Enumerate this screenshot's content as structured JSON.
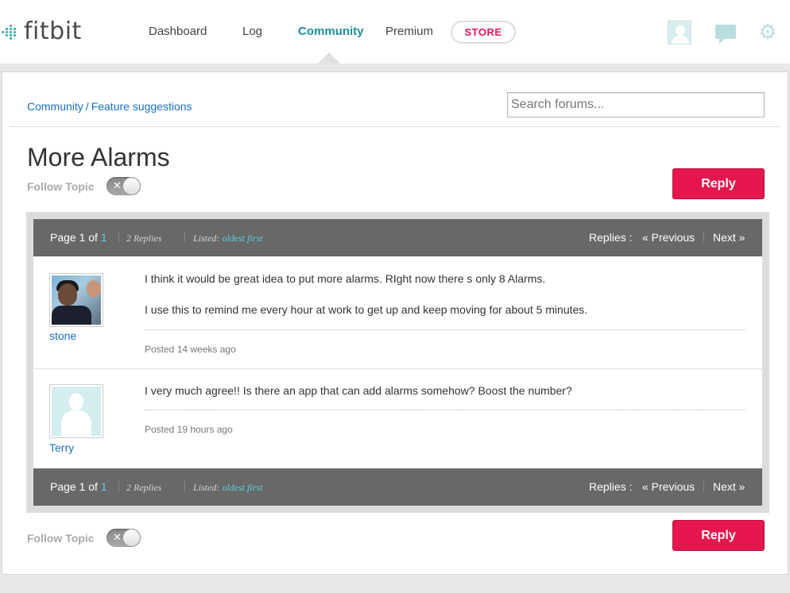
{
  "nav": {
    "logo": "fitbit",
    "items": [
      "Dashboard",
      "Log",
      "Community",
      "Premium"
    ],
    "store": "STORE"
  },
  "breadcrumb": {
    "root": "Community",
    "separator": "/",
    "current": "Feature suggestions"
  },
  "search": {
    "placeholder": "Search forums..."
  },
  "topic": {
    "title": "More Alarms",
    "follow_label": "Follow Topic",
    "reply_label": "Reply"
  },
  "pagination": {
    "page_label": "Page 1 of",
    "page_total": "1",
    "replies_count": "2 Replies",
    "listed_label": "Listed:",
    "listed_value": "oldest first",
    "replies_label": "Replies :",
    "previous": "« Previous",
    "next": "Next »"
  },
  "posts": [
    {
      "user": "stone",
      "lines": [
        "I think it would be great idea to put more alarms. RIght now there s only 8 Alarms.",
        "I use this to remind me every hour at work to get up and keep moving for about 5 minutes."
      ],
      "posted": "Posted 14 weeks ago"
    },
    {
      "user": "Terry",
      "lines": [
        "I very much agree!! Is there an app that can add alarms somehow? Boost the number?"
      ],
      "posted": "Posted 19 hours ago"
    }
  ],
  "colors": {
    "accent": "#1e8fa0",
    "reply": "#e5174e",
    "store": "#e5175a",
    "link": "#1a6fc4",
    "bar": "#686868"
  }
}
